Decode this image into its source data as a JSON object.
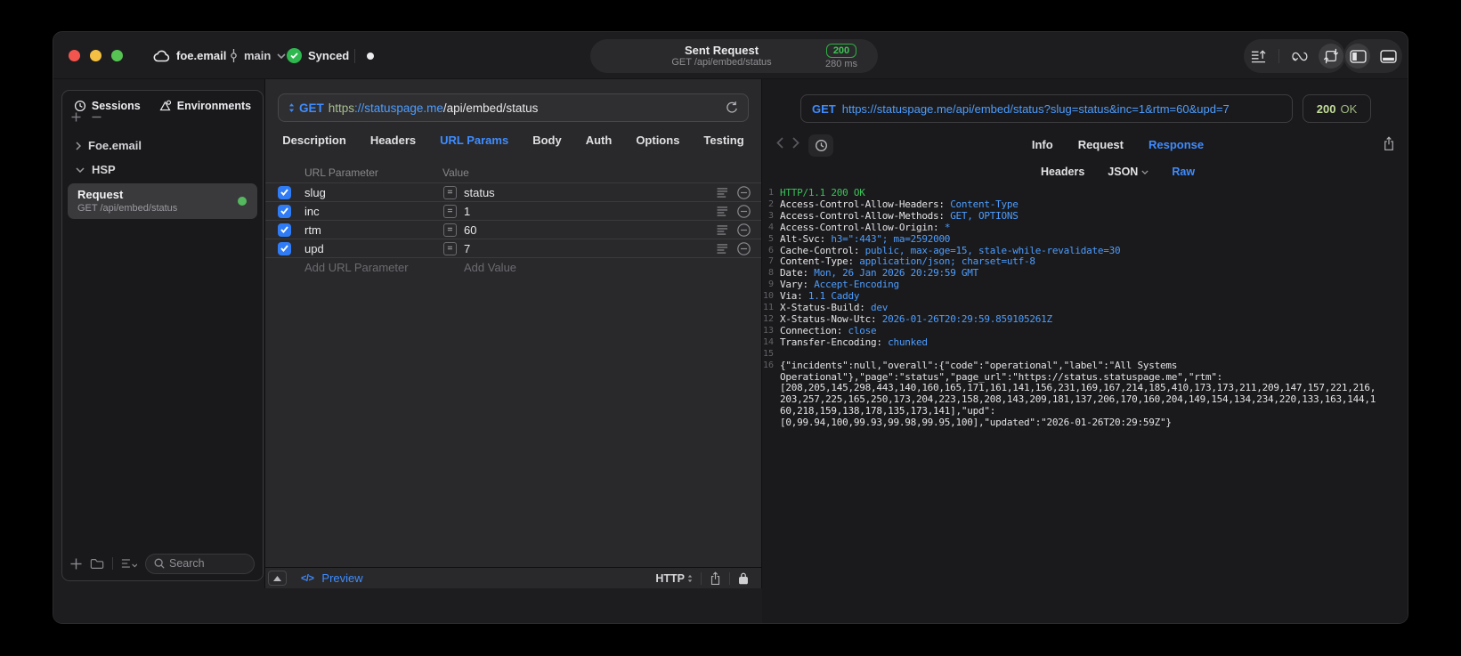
{
  "titlebar": {
    "project": "foe.email",
    "branch": "main",
    "sync_label": "Synced",
    "center_title": "Sent Request",
    "center_subtitle": "GET /api/embed/status",
    "status_code": "200",
    "response_time": "280 ms"
  },
  "colors": {
    "accent_blue": "#3f8cff",
    "link_blue": "#4d9dff",
    "success_green": "#3cc35a",
    "badge_green": "#2fae43",
    "pale_green_200": "#c4de9a",
    "checkbox_blue": "#2f7cf6"
  },
  "sidebar": {
    "tabs": [
      {
        "label": "Sessions",
        "icon": "history-clock-icon"
      },
      {
        "label": "Environments",
        "icon": "environments-icon"
      }
    ],
    "tree": {
      "collapsed_group": "Foe.email",
      "expanded_group": "HSP"
    },
    "request_item": {
      "title": "Request",
      "subtitle": "GET /api/embed/status"
    },
    "search_placeholder": "Search"
  },
  "request": {
    "method": "GET",
    "url_scheme": "https",
    "url_host": "://statuspage.me",
    "url_path": "/api/embed/status",
    "tabs": [
      "Description",
      "Headers",
      "URL Params",
      "Body",
      "Auth",
      "Options",
      "Testing"
    ],
    "active_tab": "URL Params",
    "params": {
      "col_name": "URL Parameter",
      "col_value": "Value",
      "operator": "=",
      "rows": [
        {
          "name": "slug",
          "value": "status",
          "enabled": true
        },
        {
          "name": "inc",
          "value": "1",
          "enabled": true
        },
        {
          "name": "rtm",
          "value": "60",
          "enabled": true
        },
        {
          "name": "upd",
          "value": "7",
          "enabled": true
        }
      ],
      "add_name": "Add URL Parameter",
      "add_value": "Add Value"
    },
    "footer": {
      "code_glyph": "</>",
      "preview": "Preview",
      "protocol": "HTTP"
    }
  },
  "response": {
    "request_line_method": "GET",
    "request_line_url": "https://statuspage.me/api/embed/status?slug=status&inc=1&rtm=60&upd=7",
    "status_code": "200",
    "status_text": "OK",
    "tabs": [
      "Info",
      "Request",
      "Response"
    ],
    "active_tab": "Response",
    "subtabs": [
      "Headers",
      "JSON",
      "Raw"
    ],
    "active_subtab": "Raw",
    "status_line": "HTTP/1.1 200 OK",
    "headers": [
      {
        "name": "Access-Control-Allow-Headers",
        "value": "Content-Type"
      },
      {
        "name": "Access-Control-Allow-Methods",
        "value": "GET, OPTIONS"
      },
      {
        "name": "Access-Control-Allow-Origin",
        "value": "*"
      },
      {
        "name": "Alt-Svc",
        "value": "h3=\":443\"; ma=2592000"
      },
      {
        "name": "Cache-Control",
        "value": "public, max-age=15, stale-while-revalidate=30"
      },
      {
        "name": "Content-Type",
        "value": "application/json; charset=utf-8"
      },
      {
        "name": "Date",
        "value": "Mon, 26 Jan 2026 20:29:59 GMT"
      },
      {
        "name": "Vary",
        "value": "Accept-Encoding"
      },
      {
        "name": "Via",
        "value": "1.1 Caddy"
      },
      {
        "name": "X-Status-Build",
        "value": "dev"
      },
      {
        "name": "X-Status-Now-Utc",
        "value": "2026-01-26T20:29:59.859105261Z"
      },
      {
        "name": "Connection",
        "value": "close"
      },
      {
        "name": "Transfer-Encoding",
        "value": "chunked"
      }
    ],
    "body_lines": [
      "{\"incidents\":null,\"overall\":{\"code\":\"operational\",\"label\":\"All Systems",
      "Operational\"},\"page\":\"status\",\"page_url\":\"https://status.statuspage.me\",\"rtm\":",
      "[208,205,145,298,443,140,160,165,171,161,141,156,231,169,167,214,185,410,173,173,211,209,147,157,221,216,",
      "203,257,225,165,250,173,204,223,158,208,143,209,181,137,206,170,160,204,149,154,134,234,220,133,163,144,1",
      "60,218,159,138,178,135,173,141],\"upd\":",
      "[0,99.94,100,99.93,99.98,99.95,100],\"updated\":\"2026-01-26T20:29:59Z\"}"
    ]
  }
}
